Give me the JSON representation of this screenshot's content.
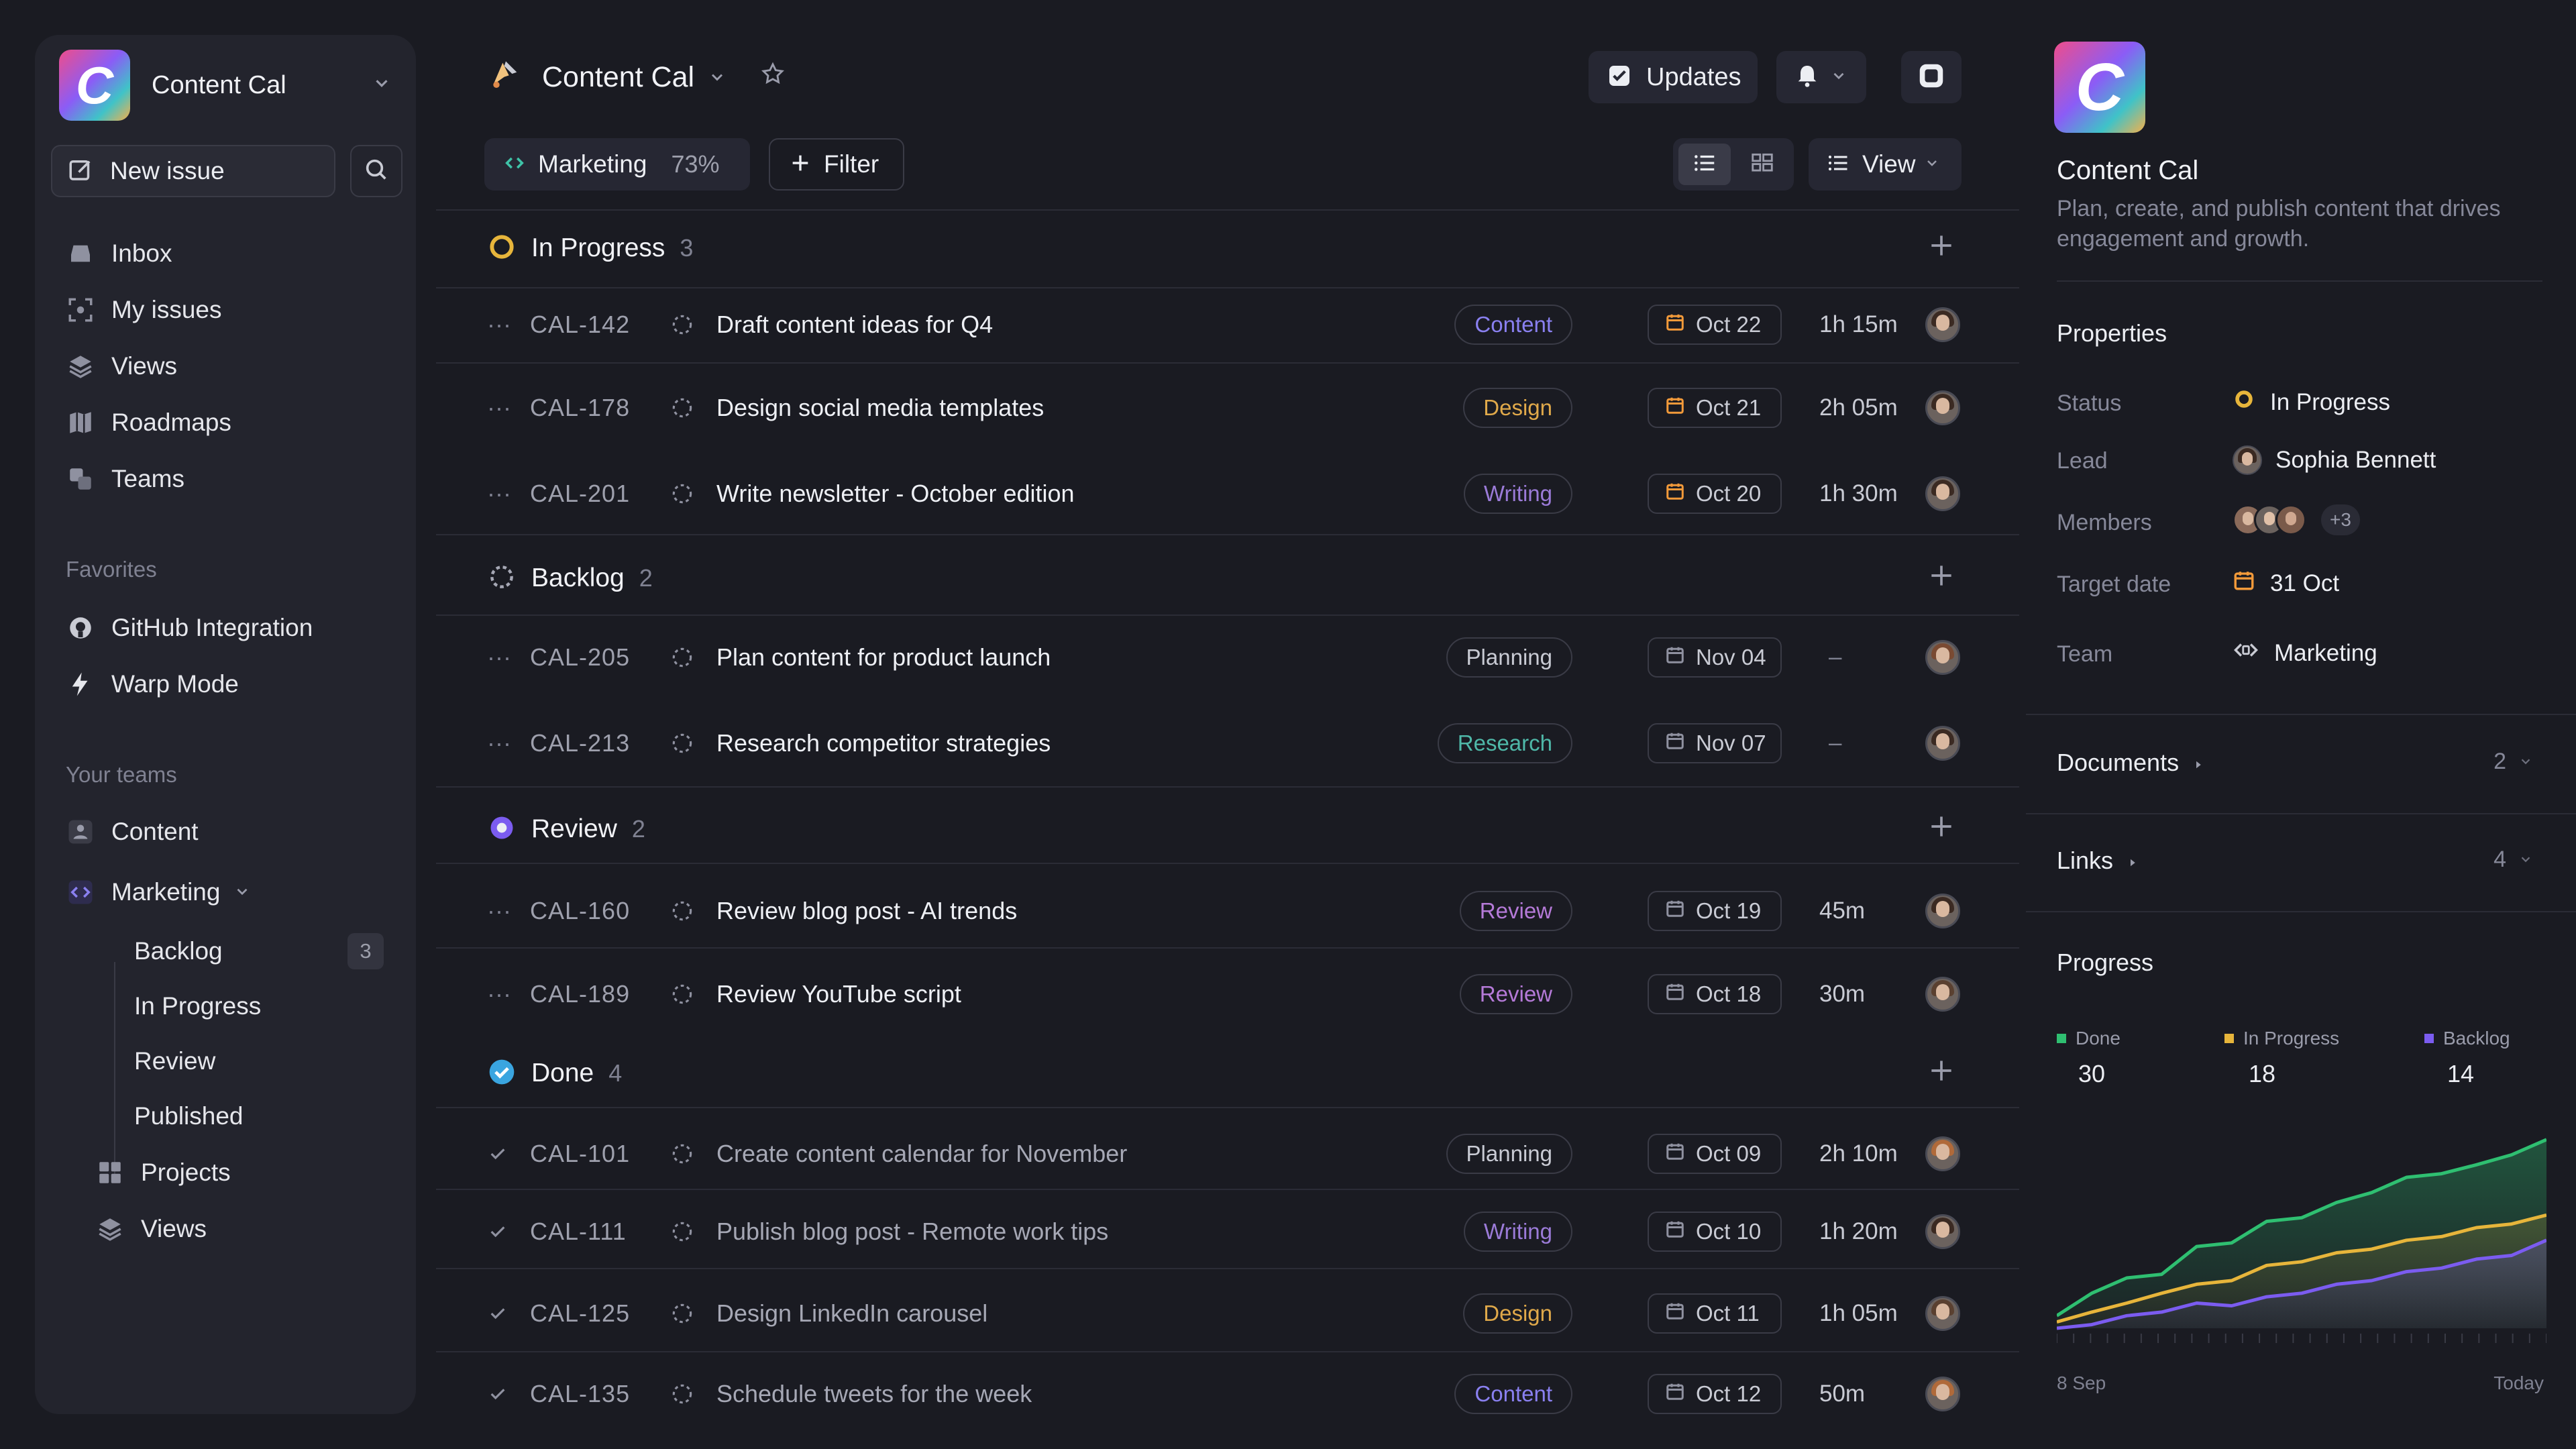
{
  "sidebar": {
    "workspace_name": "Content Cal",
    "new_issue": "New issue",
    "nav": [
      "Inbox",
      "My issues",
      "Views",
      "Roadmaps",
      "Teams"
    ],
    "favorites_label": "Favorites",
    "favorites": [
      "GitHub Integration",
      "Warp Mode"
    ],
    "teams_label": "Your teams",
    "teams": {
      "content": "Content",
      "marketing": "Marketing",
      "sub": [
        "Backlog",
        "In Progress",
        "Review",
        "Published"
      ],
      "backlog_count": "3",
      "projects": "Projects",
      "views": "Views"
    }
  },
  "header": {
    "title": "Content Cal",
    "updates": "Updates",
    "chip_team": "Marketing",
    "chip_pct": "73%",
    "filter": "Filter",
    "view": "View"
  },
  "groups": [
    {
      "name": "In Progress",
      "count": "3",
      "status": "in-progress"
    },
    {
      "name": "Backlog",
      "count": "2",
      "status": "backlog"
    },
    {
      "name": "Review",
      "count": "2",
      "status": "review"
    },
    {
      "name": "Done",
      "count": "4",
      "status": "done"
    }
  ],
  "issues": [
    {
      "id": "CAL-142",
      "title": "Draft content ideas for Q4",
      "tag": "Content",
      "tag_color": "#8a80f0",
      "date": "Oct 22",
      "date_color": "#f29a3a",
      "est": "1h 15m",
      "done": false
    },
    {
      "id": "CAL-178",
      "title": "Design social media templates",
      "tag": "Design",
      "tag_color": "#e0a94a",
      "date": "Oct 21",
      "date_color": "#f29a3a",
      "est": "2h 05m",
      "done": false
    },
    {
      "id": "CAL-201",
      "title": "Write newsletter - October edition",
      "tag": "Writing",
      "tag_color": "#9b7bd8",
      "date": "Oct 20",
      "date_color": "#f29a3a",
      "est": "1h 30m",
      "done": false
    },
    {
      "id": "CAL-205",
      "title": "Plan content for product launch",
      "tag": "Planning",
      "tag_color": "#c9cbd4",
      "date": "Nov 04",
      "date_color": "#8f91a0",
      "est": "–",
      "done": false
    },
    {
      "id": "CAL-213",
      "title": "Research competitor strategies",
      "tag": "Research",
      "tag_color": "#4fb8a8",
      "date": "Nov 07",
      "date_color": "#8f91a0",
      "est": "–",
      "done": false
    },
    {
      "id": "CAL-160",
      "title": "Review blog post - AI trends",
      "tag": "Review",
      "tag_color": "#b57ad8",
      "date": "Oct 19",
      "date_color": "#8f91a0",
      "est": "45m",
      "done": false
    },
    {
      "id": "CAL-189",
      "title": "Review YouTube script",
      "tag": "Review",
      "tag_color": "#b57ad8",
      "date": "Oct 18",
      "date_color": "#8f91a0",
      "est": "30m",
      "done": false
    },
    {
      "id": "CAL-101",
      "title": "Create content calendar for November",
      "tag": "Planning",
      "tag_color": "#c9cbd4",
      "date": "Oct 09",
      "date_color": "#8f91a0",
      "est": "2h 10m",
      "done": true
    },
    {
      "id": "CAL-111",
      "title": "Publish blog post - Remote work tips",
      "tag": "Writing",
      "tag_color": "#9b7bd8",
      "date": "Oct 10",
      "date_color": "#8f91a0",
      "est": "1h 20m",
      "done": true
    },
    {
      "id": "CAL-125",
      "title": "Design LinkedIn carousel",
      "tag": "Design",
      "tag_color": "#e0a94a",
      "date": "Oct 11",
      "date_color": "#8f91a0",
      "est": "1h 05m",
      "done": true
    },
    {
      "id": "CAL-135",
      "title": "Schedule tweets for the week",
      "tag": "Content",
      "tag_color": "#8a80f0",
      "date": "Oct 12",
      "date_color": "#8f91a0",
      "est": "50m",
      "done": true
    }
  ],
  "panel": {
    "name": "Content Cal",
    "description_line1": "Plan, create, and publish content that drives",
    "description_line2": "engagement and growth.",
    "properties_label": "Properties",
    "status_label": "Status",
    "status_value": "In Progress",
    "lead_label": "Lead",
    "lead_value": "Sophia Bennett",
    "members_label": "Members",
    "members_extra": "+3",
    "target_label": "Target date",
    "target_value": "31 Oct",
    "team_label": "Team",
    "team_value": "Marketing",
    "documents_label": "Documents",
    "documents_count": "2",
    "links_label": "Links",
    "links_count": "4",
    "progress_label": "Progress",
    "legend": [
      {
        "name": "Done",
        "value": "30",
        "color": "#2fbf71"
      },
      {
        "name": "In Progress",
        "value": "18",
        "color": "#e7b53b"
      },
      {
        "name": "Backlog",
        "value": "14",
        "color": "#7b5cf0"
      }
    ],
    "chart_start": "8 Sep",
    "chart_end": "Today"
  },
  "colors": {
    "accent_orange": "#f29a3a",
    "in_progress": "#e7b53b",
    "review": "#7b5cf0",
    "done": "#3aa5e0"
  },
  "chart_data": {
    "type": "area",
    "x_range_labels": [
      "8 Sep",
      "Today"
    ],
    "series": [
      {
        "name": "Done",
        "values": [
          2,
          6,
          8,
          9,
          13,
          14,
          17,
          18,
          20,
          22,
          24,
          25,
          26,
          28,
          30
        ]
      },
      {
        "name": "In Progress",
        "values": [
          1,
          3,
          4,
          6,
          7,
          8,
          10,
          11,
          12,
          13,
          14,
          15,
          16,
          17,
          18
        ]
      },
      {
        "name": "Backlog",
        "values": [
          0,
          1,
          2,
          3,
          4,
          4,
          5,
          6,
          7,
          8,
          9,
          10,
          11,
          12,
          14
        ]
      }
    ]
  }
}
